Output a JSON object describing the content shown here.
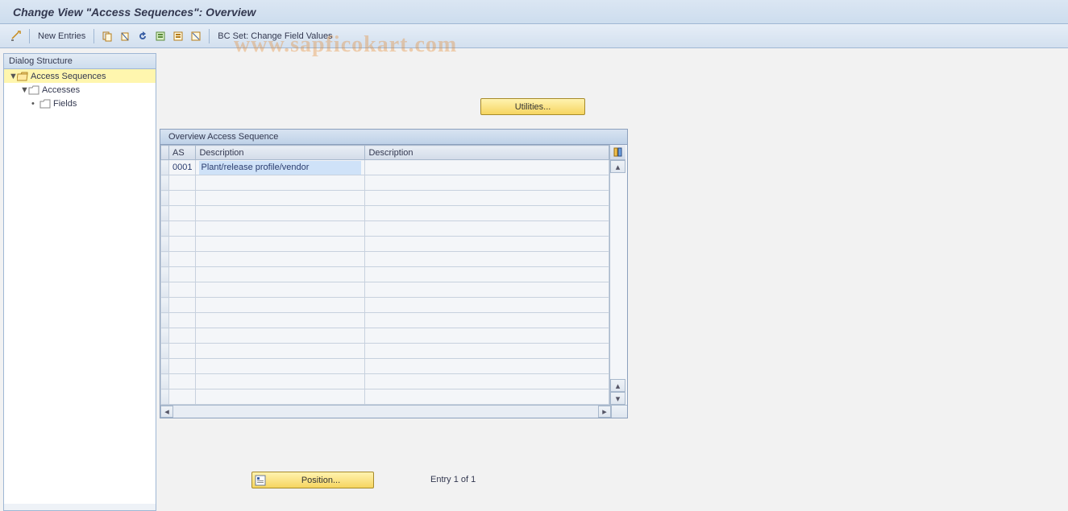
{
  "title": "Change View \"Access Sequences\": Overview",
  "watermark": "www.sapficokart.com",
  "toolbar": {
    "new_entries": "New Entries",
    "bc_set": "BC Set: Change Field Values"
  },
  "sidebar": {
    "header": "Dialog Structure",
    "items": [
      {
        "label": "Access Sequences",
        "level": 0,
        "open": true,
        "selected": true
      },
      {
        "label": "Accesses",
        "level": 1,
        "open": true,
        "selected": false
      },
      {
        "label": "Fields",
        "level": 2,
        "open": false,
        "selected": false
      }
    ]
  },
  "buttons": {
    "utilities": "Utilities...",
    "position": "Position..."
  },
  "entry_text": "Entry 1 of 1",
  "panel": {
    "title": "Overview Access Sequence",
    "columns": {
      "as": "AS",
      "desc1": "Description",
      "desc2": "Description"
    },
    "rows": [
      {
        "as": "0001",
        "desc1": "Plant/release profile/vendor",
        "desc2": ""
      }
    ],
    "empty_rows": 15
  }
}
